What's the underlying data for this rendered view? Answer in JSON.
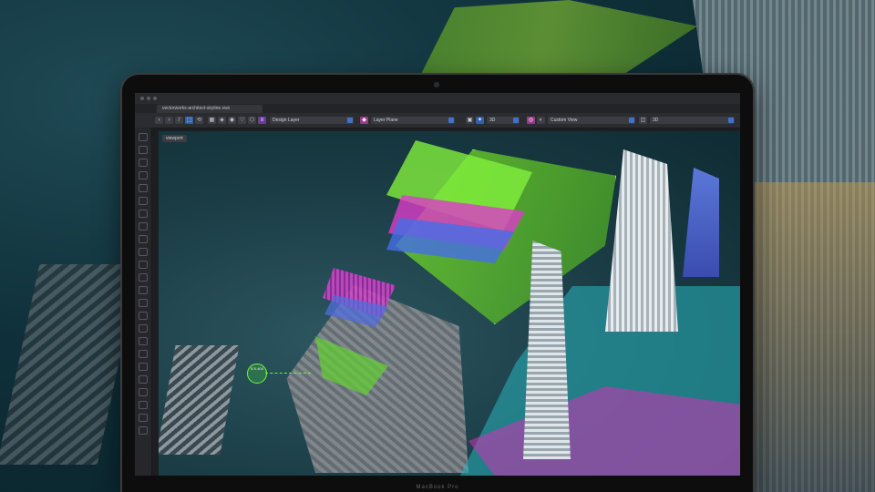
{
  "window": {
    "tab_title": "vectorworks-architect-skyline.vwx"
  },
  "toolbar": {
    "design_layer_label": "Design Layer",
    "layer_plane_label": "Layer Plane",
    "render_value": "3D",
    "view_label": "Custom View",
    "projection_value": "3D"
  },
  "viewport": {
    "label": "viewport",
    "marker_text": "B\n0.404"
  },
  "device": {
    "brand_text": "MacBook Pro"
  },
  "colors": {
    "accent_blue": "#3f73c9",
    "layer_green": "#78e628",
    "layer_magenta": "#dc3cc8",
    "layer_blue": "#466ee6",
    "layer_cyan": "#28b4be"
  }
}
